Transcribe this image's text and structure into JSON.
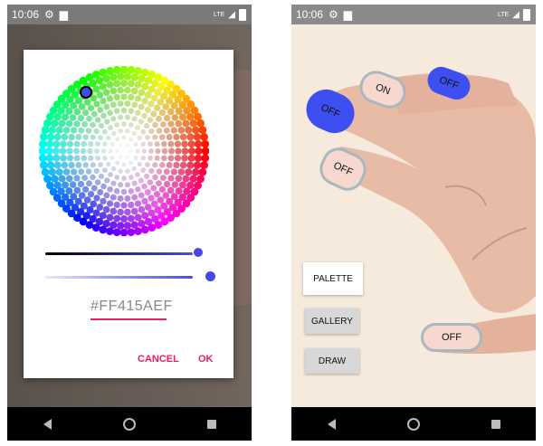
{
  "status": {
    "time": "10:06",
    "network": "LTE"
  },
  "color_picker": {
    "hex_value": "#FF415AEF",
    "cancel_label": "CANCEL",
    "ok_label": "OK"
  },
  "nails": {
    "index": "OFF",
    "middle": "ON",
    "ring": "OFF",
    "pinky": "OFF",
    "thumb": "OFF"
  },
  "buttons": {
    "palette": "PALETTE",
    "gallery": "GALLERY",
    "draw": "DRAW"
  },
  "colors": {
    "accent": "#e91e63",
    "selected": "#3d4ff0",
    "chip": "#f6d8ce"
  }
}
